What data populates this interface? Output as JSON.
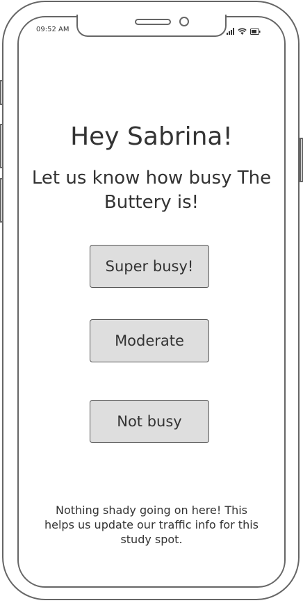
{
  "status_bar": {
    "time": "09:52 AM",
    "icons": [
      "signal-icon",
      "wifi-icon",
      "battery-icon"
    ]
  },
  "screen": {
    "greeting": "Hey Sabrina!",
    "prompt": "Let us know how busy The Buttery is!",
    "buttons": [
      {
        "label": "Super busy!"
      },
      {
        "label": "Moderate"
      },
      {
        "label": "Not busy"
      }
    ],
    "footnote": "Nothing shady going on here! This helps us update our traffic info for this study spot."
  },
  "colors": {
    "outline": "#666666",
    "button_fill": "#dedede",
    "text": "#333333"
  }
}
